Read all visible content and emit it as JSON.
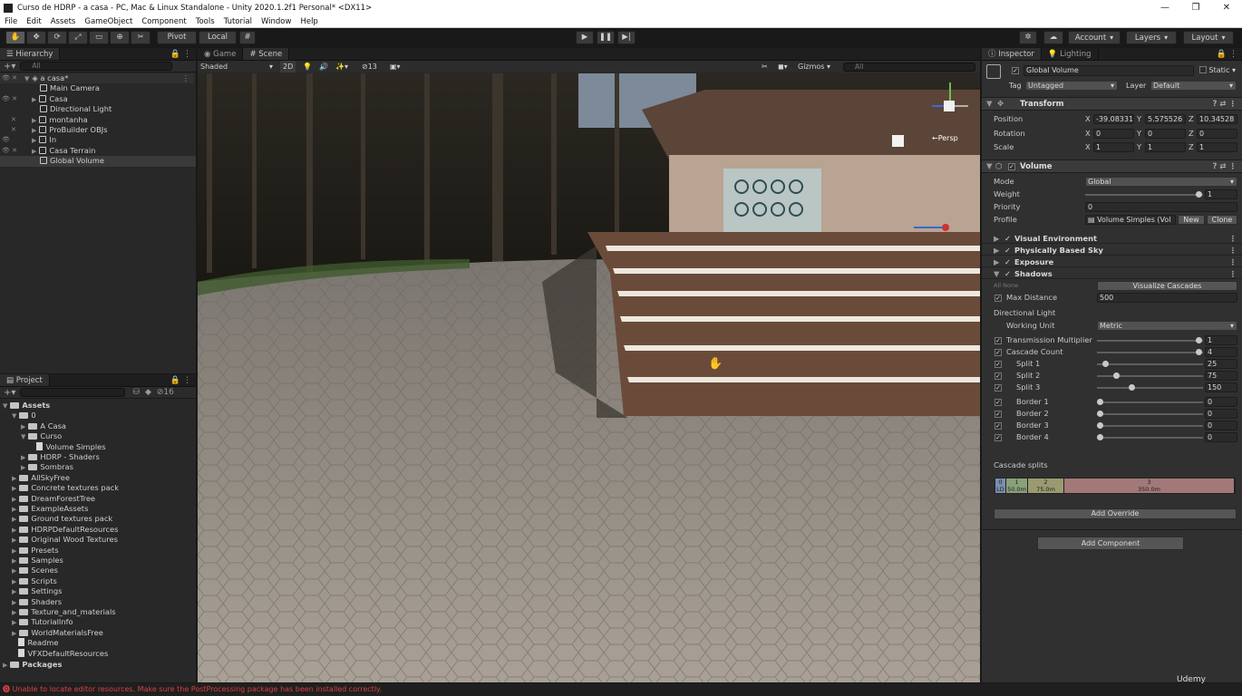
{
  "window": {
    "title": "Curso de HDRP - a casa - PC, Mac & Linux Standalone - Unity 2020.1.2f1 Personal* <DX11>",
    "buttons": [
      "—",
      "❐",
      "✕"
    ]
  },
  "menu": [
    "File",
    "Edit",
    "Assets",
    "GameObject",
    "Component",
    "Tools",
    "Tutorial",
    "Window",
    "Help"
  ],
  "toolbar": {
    "pivot": "Pivot",
    "local": "Local",
    "account": "Account",
    "layers": "Layers",
    "layout": "Layout"
  },
  "hierarchy": {
    "tab": "Hierarchy",
    "search_placeholder": "All",
    "scene_name": "a casa*",
    "items": [
      {
        "label": "Main Camera"
      },
      {
        "label": "Casa"
      },
      {
        "label": "Directional Light"
      },
      {
        "label": "montanha"
      },
      {
        "label": "ProBuilder OBJs"
      },
      {
        "label": "In"
      },
      {
        "label": "Casa Terrain"
      },
      {
        "label": "Global Volume"
      }
    ]
  },
  "project": {
    "tab": "Project",
    "hidden_count": "16",
    "assets_label": "Assets",
    "tree": [
      {
        "label": "0",
        "depth": 1,
        "open": true
      },
      {
        "label": "A Casa",
        "depth": 2
      },
      {
        "label": "Curso",
        "depth": 2,
        "open": true
      },
      {
        "label": "Volume Simples",
        "depth": 3,
        "file": true
      },
      {
        "label": "HDRP - Shaders",
        "depth": 2
      },
      {
        "label": "Sombras",
        "depth": 2
      },
      {
        "label": "AllSkyFree",
        "depth": 1
      },
      {
        "label": "Concrete textures pack",
        "depth": 1
      },
      {
        "label": "DreamForestTree",
        "depth": 1
      },
      {
        "label": "ExampleAssets",
        "depth": 1
      },
      {
        "label": "Ground textures pack",
        "depth": 1
      },
      {
        "label": "HDRPDefaultResources",
        "depth": 1
      },
      {
        "label": "Original Wood Textures",
        "depth": 1
      },
      {
        "label": "Presets",
        "depth": 1
      },
      {
        "label": "Samples",
        "depth": 1
      },
      {
        "label": "Scenes",
        "depth": 1
      },
      {
        "label": "Scripts",
        "depth": 1
      },
      {
        "label": "Settings",
        "depth": 1
      },
      {
        "label": "Shaders",
        "depth": 1
      },
      {
        "label": "Texture_and_materials",
        "depth": 1
      },
      {
        "label": "TutorialInfo",
        "depth": 1
      },
      {
        "label": "WorldMaterialsFree",
        "depth": 1
      },
      {
        "label": "Readme",
        "depth": 1,
        "file": true
      },
      {
        "label": "VFXDefaultResources",
        "depth": 1,
        "file": true
      }
    ],
    "packages_label": "Packages"
  },
  "scene_view": {
    "tabs": [
      "Game",
      "Scene"
    ],
    "shading": "Shaded",
    "mode_2d": "2D",
    "hidden_count": "13",
    "gizmos": "Gizmos",
    "search_placeholder": "All",
    "persp": "←Persp"
  },
  "inspector": {
    "tabs": [
      "Inspector",
      "Lighting"
    ],
    "object_name": "Global Volume",
    "static_label": "Static",
    "tag_label": "Tag",
    "tag_value": "Untagged",
    "layer_label": "Layer",
    "layer_value": "Default",
    "transform": {
      "title": "Transform",
      "position_label": "Position",
      "rotation_label": "Rotation",
      "scale_label": "Scale",
      "position": [
        "-39.08331",
        "5.575526",
        "10.34528"
      ],
      "rotation": [
        "0",
        "0",
        "0"
      ],
      "scale": [
        "1",
        "1",
        "1"
      ]
    },
    "volume": {
      "title": "Volume",
      "mode_label": "Mode",
      "mode_value": "Global",
      "weight_label": "Weight",
      "weight_value": "1",
      "priority_label": "Priority",
      "priority_value": "0",
      "profile_label": "Profile",
      "profile_value": "Volume Simples (Vol",
      "new_button": "New",
      "clone_button": "Clone"
    },
    "overrides": [
      "Visual Environment",
      "Physically Based Sky",
      "Exposure",
      "Shadows"
    ],
    "shadows": {
      "all_none": "All  None",
      "visualize_cascades": "Visualize Cascades",
      "max_distance_label": "Max Distance",
      "max_distance": "500",
      "directional_light_label": "Directional Light",
      "working_unit_label": "Working Unit",
      "working_unit": "Metric",
      "transmission_label": "Transmission  Multiplier",
      "transmission_value": "1",
      "cascade_count_label": "Cascade Count",
      "cascade_count": "4",
      "splits": [
        {
          "label": "Split 1",
          "value": "25",
          "fraction": 0.05
        },
        {
          "label": "Split 2",
          "value": "75",
          "fraction": 0.15
        },
        {
          "label": "Split 3",
          "value": "150",
          "fraction": 0.3
        }
      ],
      "borders": [
        {
          "label": "Border 1",
          "value": "0"
        },
        {
          "label": "Border 2",
          "value": "0"
        },
        {
          "label": "Border 3",
          "value": "0"
        },
        {
          "label": "Border 4",
          "value": "0"
        }
      ],
      "cascade_splits_label": "Cascade splits",
      "cascade_bar": [
        {
          "idx": "0",
          "dist": "LD",
          "color": "#7a8fb0"
        },
        {
          "idx": "1",
          "dist": "50.0m",
          "color": "#8aa07a"
        },
        {
          "idx": "2",
          "dist": "75.0m",
          "color": "#9a9a70"
        },
        {
          "idx": "3",
          "dist": "350.0m",
          "color": "#a37878"
        }
      ]
    },
    "add_override": "Add Override",
    "add_component": "Add Component"
  },
  "status": {
    "message": "Unable to locate editor resources. Make sure the PostProcessing package has been installed correctly."
  },
  "watermark": "Udemy"
}
